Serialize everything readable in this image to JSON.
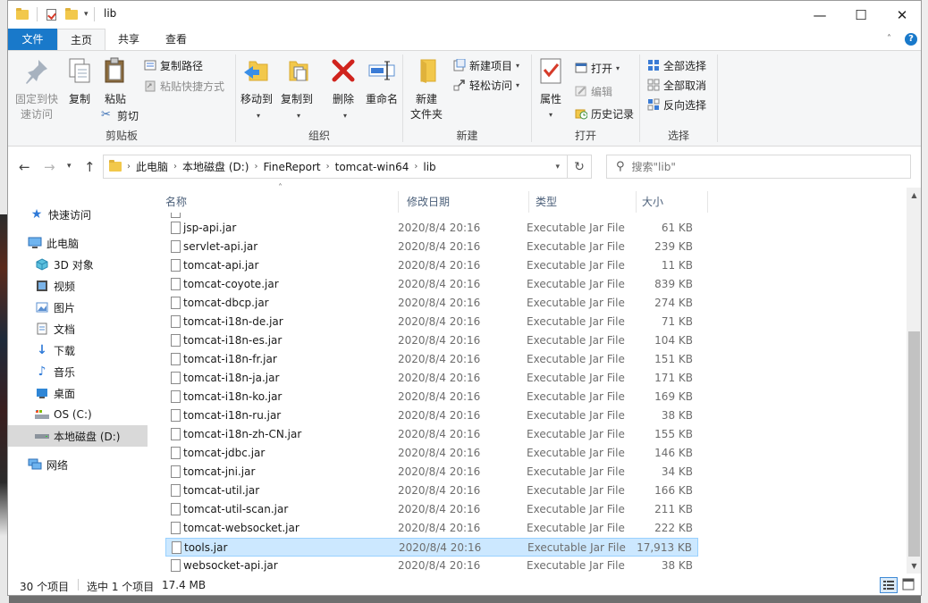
{
  "window": {
    "title": "lib",
    "minimize": "—",
    "maximize": "☐",
    "close": "✕"
  },
  "ribbon_tabs": {
    "file": "文件",
    "home": "主页",
    "share": "共享",
    "view": "查看"
  },
  "clipboard": {
    "pin": "固定到快",
    "pin2": "速访问",
    "copy": "复制",
    "paste": "粘贴",
    "copy_path": "复制路径",
    "paste_shortcut": "粘贴快捷方式",
    "cut": "剪切",
    "label": "剪贴板"
  },
  "organize": {
    "move_to": "移动到",
    "copy_to": "复制到",
    "delete": "删除",
    "rename": "重命名",
    "label": "组织"
  },
  "new_group": {
    "new_folder": "新建",
    "new_folder2": "文件夹",
    "new_item": "新建项目",
    "easy_access": "轻松访问",
    "label": "新建"
  },
  "open_group": {
    "properties": "属性",
    "open": "打开",
    "edit": "编辑",
    "history": "历史记录",
    "label": "打开"
  },
  "select_group": {
    "select_all": "全部选择",
    "select_none": "全部取消",
    "invert": "反向选择",
    "label": "选择"
  },
  "address": {
    "crumbs": [
      "此电脑",
      "本地磁盘 (D:)",
      "FineReport",
      "tomcat-win64",
      "lib"
    ],
    "search_placeholder": "搜索\"lib\""
  },
  "nav": {
    "quick_access": "快速访问",
    "this_pc": "此电脑",
    "objects3d": "3D 对象",
    "videos": "视频",
    "pictures": "图片",
    "documents": "文档",
    "downloads": "下载",
    "music": "音乐",
    "desktop": "桌面",
    "os_c": "OS (C:)",
    "local_d": "本地磁盘 (D:)",
    "network": "网络"
  },
  "columns": {
    "name": "名称",
    "date": "修改日期",
    "type": "类型",
    "size": "大小"
  },
  "files": [
    {
      "name": "jsp-api.jar",
      "date": "2020/8/4 20:16",
      "type": "Executable Jar File",
      "size": "61 KB"
    },
    {
      "name": "servlet-api.jar",
      "date": "2020/8/4 20:16",
      "type": "Executable Jar File",
      "size": "239 KB"
    },
    {
      "name": "tomcat-api.jar",
      "date": "2020/8/4 20:16",
      "type": "Executable Jar File",
      "size": "11 KB"
    },
    {
      "name": "tomcat-coyote.jar",
      "date": "2020/8/4 20:16",
      "type": "Executable Jar File",
      "size": "839 KB"
    },
    {
      "name": "tomcat-dbcp.jar",
      "date": "2020/8/4 20:16",
      "type": "Executable Jar File",
      "size": "274 KB"
    },
    {
      "name": "tomcat-i18n-de.jar",
      "date": "2020/8/4 20:16",
      "type": "Executable Jar File",
      "size": "71 KB"
    },
    {
      "name": "tomcat-i18n-es.jar",
      "date": "2020/8/4 20:16",
      "type": "Executable Jar File",
      "size": "104 KB"
    },
    {
      "name": "tomcat-i18n-fr.jar",
      "date": "2020/8/4 20:16",
      "type": "Executable Jar File",
      "size": "151 KB"
    },
    {
      "name": "tomcat-i18n-ja.jar",
      "date": "2020/8/4 20:16",
      "type": "Executable Jar File",
      "size": "171 KB"
    },
    {
      "name": "tomcat-i18n-ko.jar",
      "date": "2020/8/4 20:16",
      "type": "Executable Jar File",
      "size": "169 KB"
    },
    {
      "name": "tomcat-i18n-ru.jar",
      "date": "2020/8/4 20:16",
      "type": "Executable Jar File",
      "size": "38 KB"
    },
    {
      "name": "tomcat-i18n-zh-CN.jar",
      "date": "2020/8/4 20:16",
      "type": "Executable Jar File",
      "size": "155 KB"
    },
    {
      "name": "tomcat-jdbc.jar",
      "date": "2020/8/4 20:16",
      "type": "Executable Jar File",
      "size": "146 KB"
    },
    {
      "name": "tomcat-jni.jar",
      "date": "2020/8/4 20:16",
      "type": "Executable Jar File",
      "size": "34 KB"
    },
    {
      "name": "tomcat-util.jar",
      "date": "2020/8/4 20:16",
      "type": "Executable Jar File",
      "size": "166 KB"
    },
    {
      "name": "tomcat-util-scan.jar",
      "date": "2020/8/4 20:16",
      "type": "Executable Jar File",
      "size": "211 KB"
    },
    {
      "name": "tomcat-websocket.jar",
      "date": "2020/8/4 20:16",
      "type": "Executable Jar File",
      "size": "222 KB"
    },
    {
      "name": "tools.jar",
      "date": "2020/8/4 20:16",
      "type": "Executable Jar File",
      "size": "17,913 KB",
      "selected": true
    },
    {
      "name": "websocket-api.jar",
      "date": "2020/8/4 20:16",
      "type": "Executable Jar File",
      "size": "38 KB"
    }
  ],
  "status": {
    "count": "30 个项目",
    "selected": "选中 1 个项目",
    "size": "17.4 MB"
  },
  "colors": {
    "accent": "#1979ca",
    "selection": "#cce8ff",
    "selection_border": "#99d1ff",
    "folder": "#f2c84b"
  }
}
